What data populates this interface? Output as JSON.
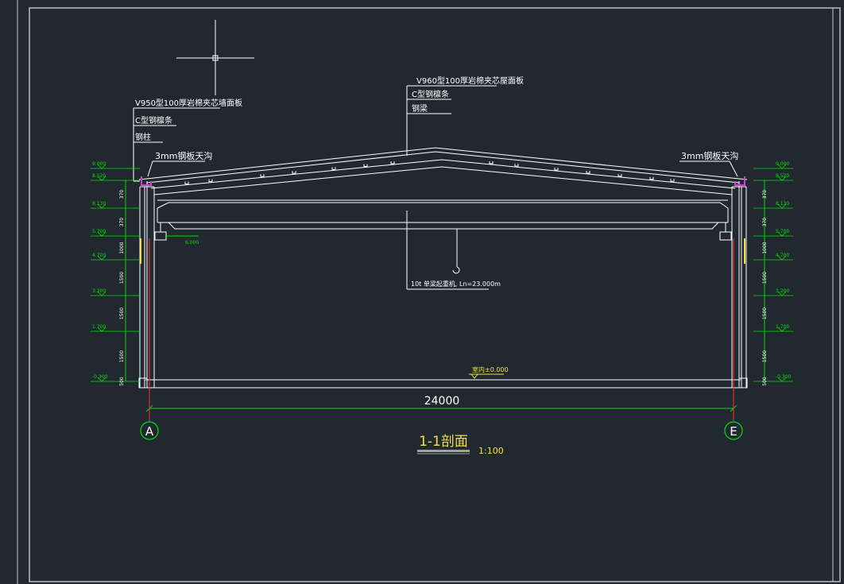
{
  "annotations": {
    "wall_panel": "V950型100厚岩棉夹芯墙面板",
    "wall_purlin": "C型钢檩条",
    "column": "钢柱",
    "roof_panel": "V960型100厚岩棉夹芯屋面板",
    "roof_purlin": "C型钢檩条",
    "beam": "钢梁",
    "gutter_left": "3mm钢板天沟",
    "gutter_right": "3mm钢板天沟",
    "crane": "10t 单梁起重机, Ln=23.000m",
    "floor_level": "室内±0.000",
    "crane_level": "6.000"
  },
  "elevations_left": [
    "9.000",
    "8.520",
    "8.130",
    "5.700",
    "4.700",
    "3.200",
    "1.700",
    "-0.300"
  ],
  "elevations_right": [
    "9.000",
    "8.520",
    "8.130",
    "5.700",
    "4.700",
    "3.200",
    "1.700",
    "-0.300"
  ],
  "dims_left": [
    "370",
    "370",
    "1000",
    "1500",
    "1500",
    "1500",
    "500"
  ],
  "dims_right": [
    "370",
    "370",
    "1000",
    "1500",
    "1500",
    "1500",
    "500"
  ],
  "span_dimension": "24000",
  "grid_axes": {
    "left": "A",
    "right": "E"
  },
  "title": {
    "name": "1-1剖面",
    "scale": "1:100"
  },
  "colors": {
    "background": "#212830",
    "line": "#ffffff",
    "dimension": "#00e000",
    "axis": "#ff3030",
    "title": "#f0e040",
    "gutter": "#d040d0"
  }
}
